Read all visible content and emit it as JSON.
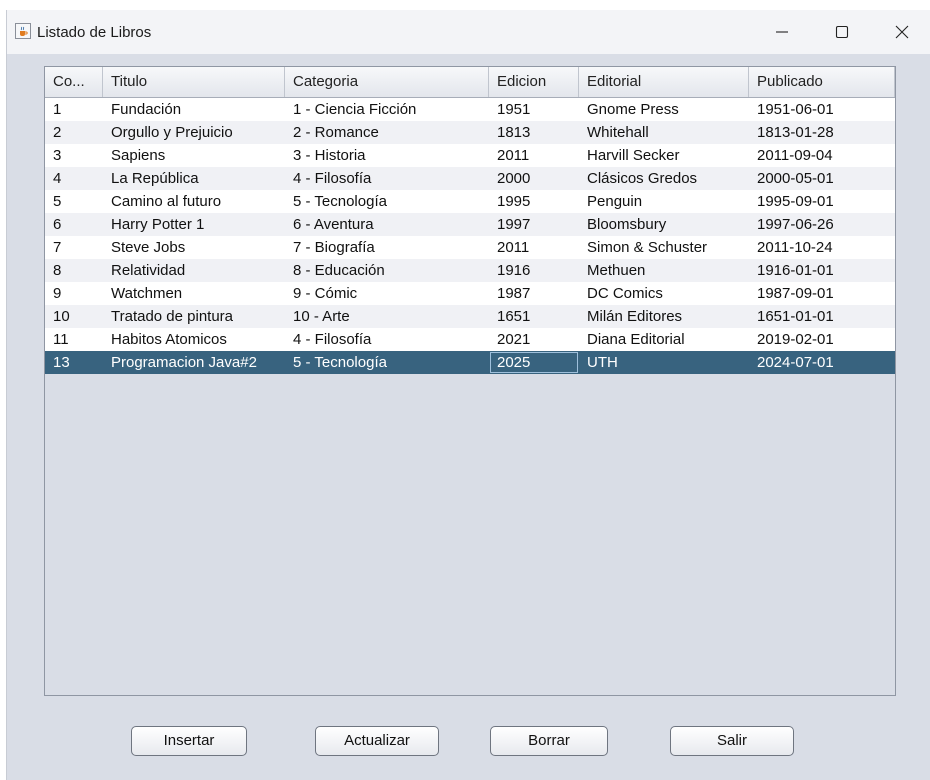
{
  "window": {
    "title": "Listado de Libros",
    "app_icon": "java-cup-icon"
  },
  "window_controls": {
    "minimize": "minimize-icon",
    "maximize": "maximize-icon",
    "close": "close-icon"
  },
  "table": {
    "columns": [
      "Co...",
      "Titulo",
      "Categoria",
      "Edicion",
      "Editorial",
      "Publicado"
    ],
    "rows": [
      [
        "1",
        "Fundación",
        "1 - Ciencia Ficción",
        "1951",
        "Gnome Press",
        "1951-06-01"
      ],
      [
        "2",
        "Orgullo y Prejuicio",
        "2 - Romance",
        "1813",
        "Whitehall",
        "1813-01-28"
      ],
      [
        "3",
        "Sapiens",
        "3 - Historia",
        "2011",
        "Harvill Secker",
        "2011-09-04"
      ],
      [
        "4",
        "La República",
        "4 - Filosofía",
        "2000",
        "Clásicos Gredos",
        "2000-05-01"
      ],
      [
        "5",
        "Camino al futuro",
        "5 - Tecnología",
        "1995",
        "Penguin",
        "1995-09-01"
      ],
      [
        "6",
        "Harry Potter 1",
        "6 - Aventura",
        "1997",
        "Bloomsbury",
        "1997-06-26"
      ],
      [
        "7",
        "Steve Jobs",
        "7 - Biografía",
        "2011",
        "Simon & Schuster",
        "2011-10-24"
      ],
      [
        "8",
        "Relatividad",
        "8 - Educación",
        "1916",
        "Methuen",
        "1916-01-01"
      ],
      [
        "9",
        "Watchmen",
        "9 - Cómic",
        "1987",
        "DC Comics",
        "1987-09-01"
      ],
      [
        "10",
        "Tratado de pintura",
        "10 - Arte",
        "1651",
        "Milán Editores",
        "1651-01-01"
      ],
      [
        "11",
        "Habitos Atomicos",
        "4 - Filosofía",
        "2021",
        "Diana Editorial",
        "2019-02-01"
      ],
      [
        "13",
        "Programacion Java#2",
        "5 - Tecnología",
        "2025",
        "UTH",
        "2024-07-01"
      ]
    ],
    "selected_row": 11,
    "colors": {
      "selection": "#38637f",
      "alt_row": "#f0f1f5",
      "panel": "#d9dde6"
    }
  },
  "buttons": {
    "insert": "Insertar",
    "update": "Actualizar",
    "delete": "Borrar",
    "exit": "Salir"
  }
}
